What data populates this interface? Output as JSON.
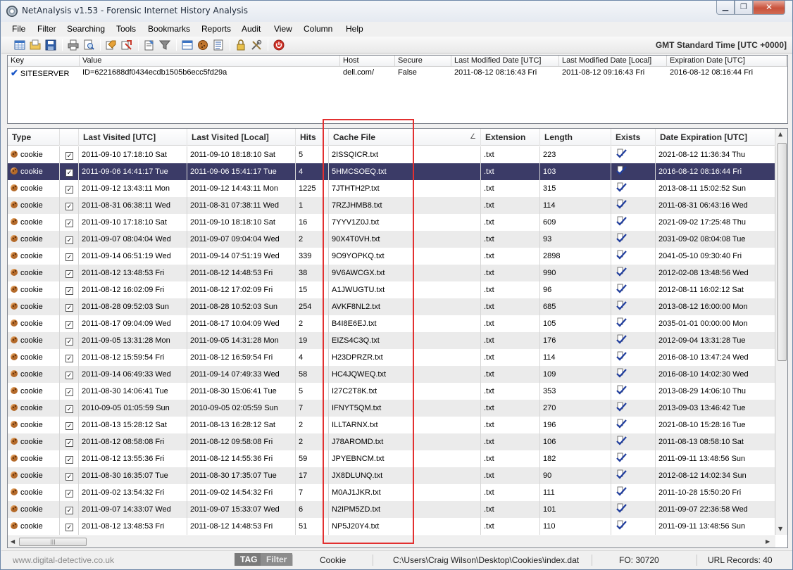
{
  "window": {
    "title": "NetAnalysis v1.53 - Forensic Internet History Analysis",
    "controls": {
      "minimize": "▁",
      "maximize": "❐",
      "close": "✕"
    }
  },
  "menu": [
    "File",
    "Filter",
    "Searching",
    "Tools",
    "Bookmarks",
    "Reports",
    "Audit",
    "View",
    "Column",
    "Help"
  ],
  "toolbar": {
    "timezone": "GMT Standard Time [UTC +0000]"
  },
  "cookie_key_table": {
    "columns": [
      "Key",
      "Value",
      "Host",
      "Secure",
      "Last Modified Date [UTC]",
      "Last Modified Date [Local]",
      "Expiration Date [UTC]"
    ],
    "rows": [
      {
        "key": "SITESERVER",
        "value": "ID=6221688df0434ecdb1505b6ecc5fd29a",
        "host": "dell.com/",
        "secure": "False",
        "modified_utc": "2011-08-12 08:16:43 Fri",
        "modified_local": "2011-08-12 09:16:43 Fri",
        "expiration_utc": "2016-08-12 08:16:44 Fri"
      }
    ]
  },
  "records_table": {
    "columns": {
      "type": "Type",
      "last_visited_utc": "Last Visited [UTC]",
      "last_visited_local": "Last Visited [Local]",
      "hits": "Hits",
      "cache_file": "Cache File",
      "extension": "Extension",
      "length": "Length",
      "exists": "Exists",
      "date_expiration": "Date Expiration [UTC]"
    },
    "sort_glyph": "∠",
    "selected_index": 1,
    "rows": [
      {
        "type": "cookie",
        "utc": "2011-09-10 17:18:10 Sat",
        "local": "2011-09-10 18:18:10 Sat",
        "hits": "5",
        "cache": "2ISSQICR.txt",
        "ext": ".txt",
        "len": "223",
        "exp": "2021-08-12 11:36:34 Thu"
      },
      {
        "type": "cookie",
        "utc": "2011-09-06 14:41:17 Tue",
        "local": "2011-09-06 15:41:17 Tue",
        "hits": "4",
        "cache": "5HMCSOEQ.txt",
        "ext": ".txt",
        "len": "103",
        "exp": "2016-08-12 08:16:44 Fri"
      },
      {
        "type": "cookie",
        "utc": "2011-09-12 13:43:11 Mon",
        "local": "2011-09-12 14:43:11 Mon",
        "hits": "1225",
        "cache": "7JTHTH2P.txt",
        "ext": ".txt",
        "len": "315",
        "exp": "2013-08-11 15:02:52 Sun"
      },
      {
        "type": "cookie",
        "utc": "2011-08-31 06:38:11 Wed",
        "local": "2011-08-31 07:38:11 Wed",
        "hits": "1",
        "cache": "7RZJHMB8.txt",
        "ext": ".txt",
        "len": "114",
        "exp": "2011-08-31 06:43:16 Wed"
      },
      {
        "type": "cookie",
        "utc": "2011-09-10 17:18:10 Sat",
        "local": "2011-09-10 18:18:10 Sat",
        "hits": "16",
        "cache": "7YYV1Z0J.txt",
        "ext": ".txt",
        "len": "609",
        "exp": "2021-09-02 17:25:48 Thu"
      },
      {
        "type": "cookie",
        "utc": "2011-09-07 08:04:04 Wed",
        "local": "2011-09-07 09:04:04 Wed",
        "hits": "2",
        "cache": "90X4T0VH.txt",
        "ext": ".txt",
        "len": "93",
        "exp": "2031-09-02 08:04:08 Tue"
      },
      {
        "type": "cookie",
        "utc": "2011-09-14 06:51:19 Wed",
        "local": "2011-09-14 07:51:19 Wed",
        "hits": "339",
        "cache": "9O9YOPKQ.txt",
        "ext": ".txt",
        "len": "2898",
        "exp": "2041-05-10 09:30:40 Fri"
      },
      {
        "type": "cookie",
        "utc": "2011-08-12 13:48:53 Fri",
        "local": "2011-08-12 14:48:53 Fri",
        "hits": "38",
        "cache": "9V6AWCGX.txt",
        "ext": ".txt",
        "len": "990",
        "exp": "2012-02-08 13:48:56 Wed"
      },
      {
        "type": "cookie",
        "utc": "2011-08-12 16:02:09 Fri",
        "local": "2011-08-12 17:02:09 Fri",
        "hits": "15",
        "cache": "A1JWUGTU.txt",
        "ext": ".txt",
        "len": "96",
        "exp": "2012-08-11 16:02:12 Sat"
      },
      {
        "type": "cookie",
        "utc": "2011-08-28 09:52:03 Sun",
        "local": "2011-08-28 10:52:03 Sun",
        "hits": "254",
        "cache": "AVKF8NL2.txt",
        "ext": ".txt",
        "len": "685",
        "exp": "2013-08-12 16:00:00 Mon"
      },
      {
        "type": "cookie",
        "utc": "2011-08-17 09:04:09 Wed",
        "local": "2011-08-17 10:04:09 Wed",
        "hits": "2",
        "cache": "B4I8E6EJ.txt",
        "ext": ".txt",
        "len": "105",
        "exp": "2035-01-01 00:00:00 Mon"
      },
      {
        "type": "cookie",
        "utc": "2011-09-05 13:31:28 Mon",
        "local": "2011-09-05 14:31:28 Mon",
        "hits": "19",
        "cache": "EIZS4C3Q.txt",
        "ext": ".txt",
        "len": "176",
        "exp": "2012-09-04 13:31:28 Tue"
      },
      {
        "type": "cookie",
        "utc": "2011-08-12 15:59:54 Fri",
        "local": "2011-08-12 16:59:54 Fri",
        "hits": "4",
        "cache": "H23DPRZR.txt",
        "ext": ".txt",
        "len": "114",
        "exp": "2016-08-10 13:47:24 Wed"
      },
      {
        "type": "cookie",
        "utc": "2011-09-14 06:49:33 Wed",
        "local": "2011-09-14 07:49:33 Wed",
        "hits": "58",
        "cache": "HC4JQWEQ.txt",
        "ext": ".txt",
        "len": "109",
        "exp": "2016-08-10 14:02:30 Wed"
      },
      {
        "type": "cookie",
        "utc": "2011-08-30 14:06:41 Tue",
        "local": "2011-08-30 15:06:41 Tue",
        "hits": "5",
        "cache": "I27C2T8K.txt",
        "ext": ".txt",
        "len": "353",
        "exp": "2013-08-29 14:06:10 Thu"
      },
      {
        "type": "cookie",
        "utc": "2010-09-05 01:05:59 Sun",
        "local": "2010-09-05 02:05:59 Sun",
        "hits": "7",
        "cache": "IFNYT5QM.txt",
        "ext": ".txt",
        "len": "270",
        "exp": "2013-09-03 13:46:42 Tue"
      },
      {
        "type": "cookie",
        "utc": "2011-08-13 15:28:12 Sat",
        "local": "2011-08-13 16:28:12 Sat",
        "hits": "2",
        "cache": "ILLTARNX.txt",
        "ext": ".txt",
        "len": "196",
        "exp": "2021-08-10 15:28:16 Tue"
      },
      {
        "type": "cookie",
        "utc": "2011-08-12 08:58:08 Fri",
        "local": "2011-08-12 09:58:08 Fri",
        "hits": "2",
        "cache": "J78AROMD.txt",
        "ext": ".txt",
        "len": "106",
        "exp": "2011-08-13 08:58:10 Sat"
      },
      {
        "type": "cookie",
        "utc": "2011-08-12 13:55:36 Fri",
        "local": "2011-08-12 14:55:36 Fri",
        "hits": "59",
        "cache": "JPYEBNCM.txt",
        "ext": ".txt",
        "len": "182",
        "exp": "2011-09-11 13:48:56 Sun"
      },
      {
        "type": "cookie",
        "utc": "2011-08-30 16:35:07 Tue",
        "local": "2011-08-30 17:35:07 Tue",
        "hits": "17",
        "cache": "JX8DLUNQ.txt",
        "ext": ".txt",
        "len": "90",
        "exp": "2012-08-12 14:02:34 Sun"
      },
      {
        "type": "cookie",
        "utc": "2011-09-02 13:54:32 Fri",
        "local": "2011-09-02 14:54:32 Fri",
        "hits": "7",
        "cache": "M0AJ1JKR.txt",
        "ext": ".txt",
        "len": "111",
        "exp": "2011-10-28 15:50:20 Fri"
      },
      {
        "type": "cookie",
        "utc": "2011-09-07 14:33:07 Wed",
        "local": "2011-09-07 15:33:07 Wed",
        "hits": "6",
        "cache": "N2IPM5ZD.txt",
        "ext": ".txt",
        "len": "101",
        "exp": "2011-09-07 22:36:58 Wed"
      },
      {
        "type": "cookie",
        "utc": "2011-08-12 13:48:53 Fri",
        "local": "2011-08-12 14:48:53 Fri",
        "hits": "51",
        "cache": "NP5J20Y4.txt",
        "ext": ".txt",
        "len": "110",
        "exp": "2011-09-11 13:48:56 Sun"
      }
    ]
  },
  "scrollbar": {
    "up": "▲",
    "down": "▼",
    "left": "◀",
    "right": "▶",
    "grip": "|||"
  },
  "status": {
    "url": "www.digital-detective.co.uk",
    "tag": "TAG",
    "filter": "Filter",
    "type": "Cookie",
    "path": "C:\\Users\\Craig Wilson\\Desktop\\Cookies\\index.dat",
    "fo": "FO: 30720",
    "records": "URL Records:  40"
  },
  "icons": {
    "checkbox_checked": "☑",
    "secure_check": "✔",
    "exists": "exists-icon",
    "cookie": "cookie-icon"
  },
  "colors": {
    "selection": "#3b3b67",
    "alt_row": "#ebebeb",
    "annotation": "#e23030",
    "exists_icon": "#1f3d9e"
  }
}
